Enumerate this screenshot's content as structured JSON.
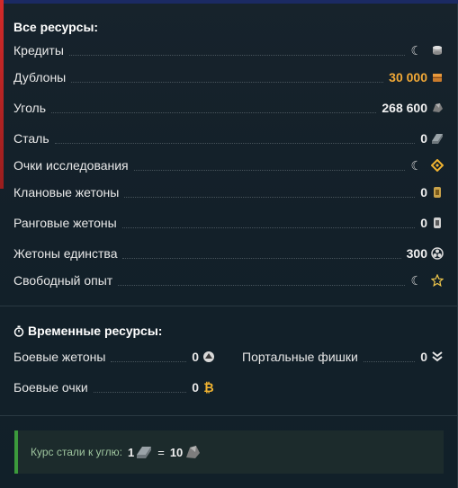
{
  "all_resources": {
    "title": "Все ресурсы:",
    "items": [
      {
        "label": "Кредиты",
        "value": "",
        "icon": "credits-icon",
        "loading": true
      },
      {
        "label": "Дублоны",
        "value": "30 000",
        "icon": "doubloons-icon",
        "accent": "#f2a937"
      },
      {
        "label": "Уголь",
        "value": "268 600",
        "icon": "coal-icon"
      },
      {
        "label": "Сталь",
        "value": "0",
        "icon": "steel-icon"
      },
      {
        "label": "Очки исследования",
        "value": "",
        "icon": "research-points-icon",
        "loading": true
      },
      {
        "label": "Клановые жетоны",
        "value": "0",
        "icon": "clan-token-icon"
      },
      {
        "label": "Ранговые жетоны",
        "value": "0",
        "icon": "ranked-token-icon"
      },
      {
        "label": "Жетоны единства",
        "value": "300",
        "icon": "unity-token-icon"
      },
      {
        "label": "Свободный опыт",
        "value": "",
        "icon": "free-xp-star-icon",
        "loading": true
      }
    ]
  },
  "temporary_resources": {
    "title": "Временные ресурсы:",
    "items": [
      {
        "label": "Боевые жетоны",
        "value": "0",
        "icon": "battle-token-icon"
      },
      {
        "label": "Портальные фишки",
        "value": "0",
        "icon": "portal-chip-icon"
      },
      {
        "label": "Боевые очки",
        "value": "0",
        "icon": "battle-points-icon"
      }
    ]
  },
  "exchange": {
    "text": "Курс стали к углю:",
    "steel_amount": "1",
    "equals": "=",
    "coal_amount": "10"
  }
}
